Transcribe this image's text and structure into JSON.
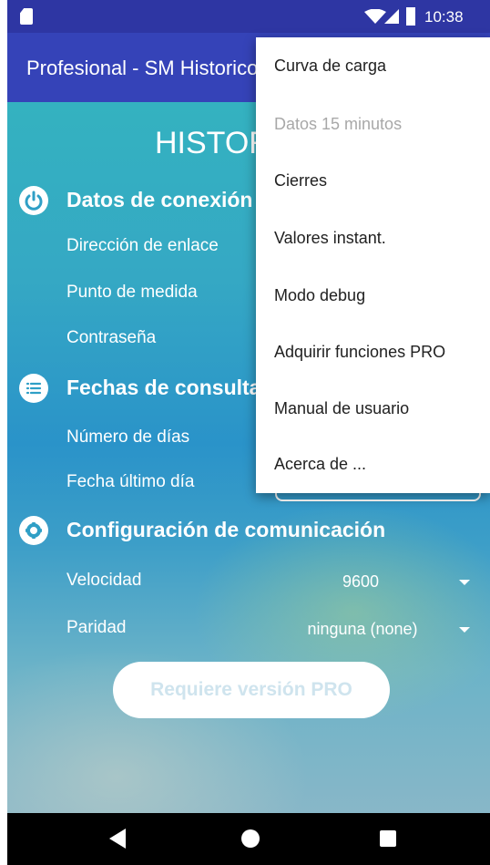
{
  "status_bar": {
    "time": "10:38"
  },
  "app_bar": {
    "title": "Profesional - SM Historicos"
  },
  "content": {
    "heading": "HISTORICOS",
    "sections": [
      {
        "title": "Datos de conexión",
        "icon": "power-icon",
        "rows": [
          "Dirección de enlace",
          "Punto de medida",
          "Contraseña"
        ]
      },
      {
        "title": "Fechas de consulta",
        "icon": "list-icon",
        "rows": [
          "Número de días",
          "Fecha último día"
        ]
      },
      {
        "title": "Configuración de comunicación",
        "icon": "gear-icon",
        "rows": [
          {
            "label": "Velocidad",
            "value": "9600"
          },
          {
            "label": "Paridad",
            "value": "ninguna (none)"
          }
        ]
      }
    ],
    "pro_button": "Requiere versión PRO"
  },
  "menu": {
    "items": [
      {
        "label": "Curva de carga",
        "enabled": true
      },
      {
        "label": "Datos 15 minutos",
        "enabled": false
      },
      {
        "label": "Cierres",
        "enabled": true
      },
      {
        "label": "Valores instant.",
        "enabled": true
      },
      {
        "label": "Modo debug",
        "enabled": true
      },
      {
        "label": "Adquirir funciones PRO",
        "enabled": true
      },
      {
        "label": "Manual de usuario",
        "enabled": true
      },
      {
        "label": "Acerca de ...",
        "enabled": true
      }
    ]
  },
  "nav_bar": {
    "icons": [
      "back-icon",
      "home-icon",
      "recents-icon"
    ]
  },
  "colors": {
    "status_bar": "#2e36a3",
    "app_bar": "#3543b8",
    "accent_teal": "#34b2c0"
  }
}
